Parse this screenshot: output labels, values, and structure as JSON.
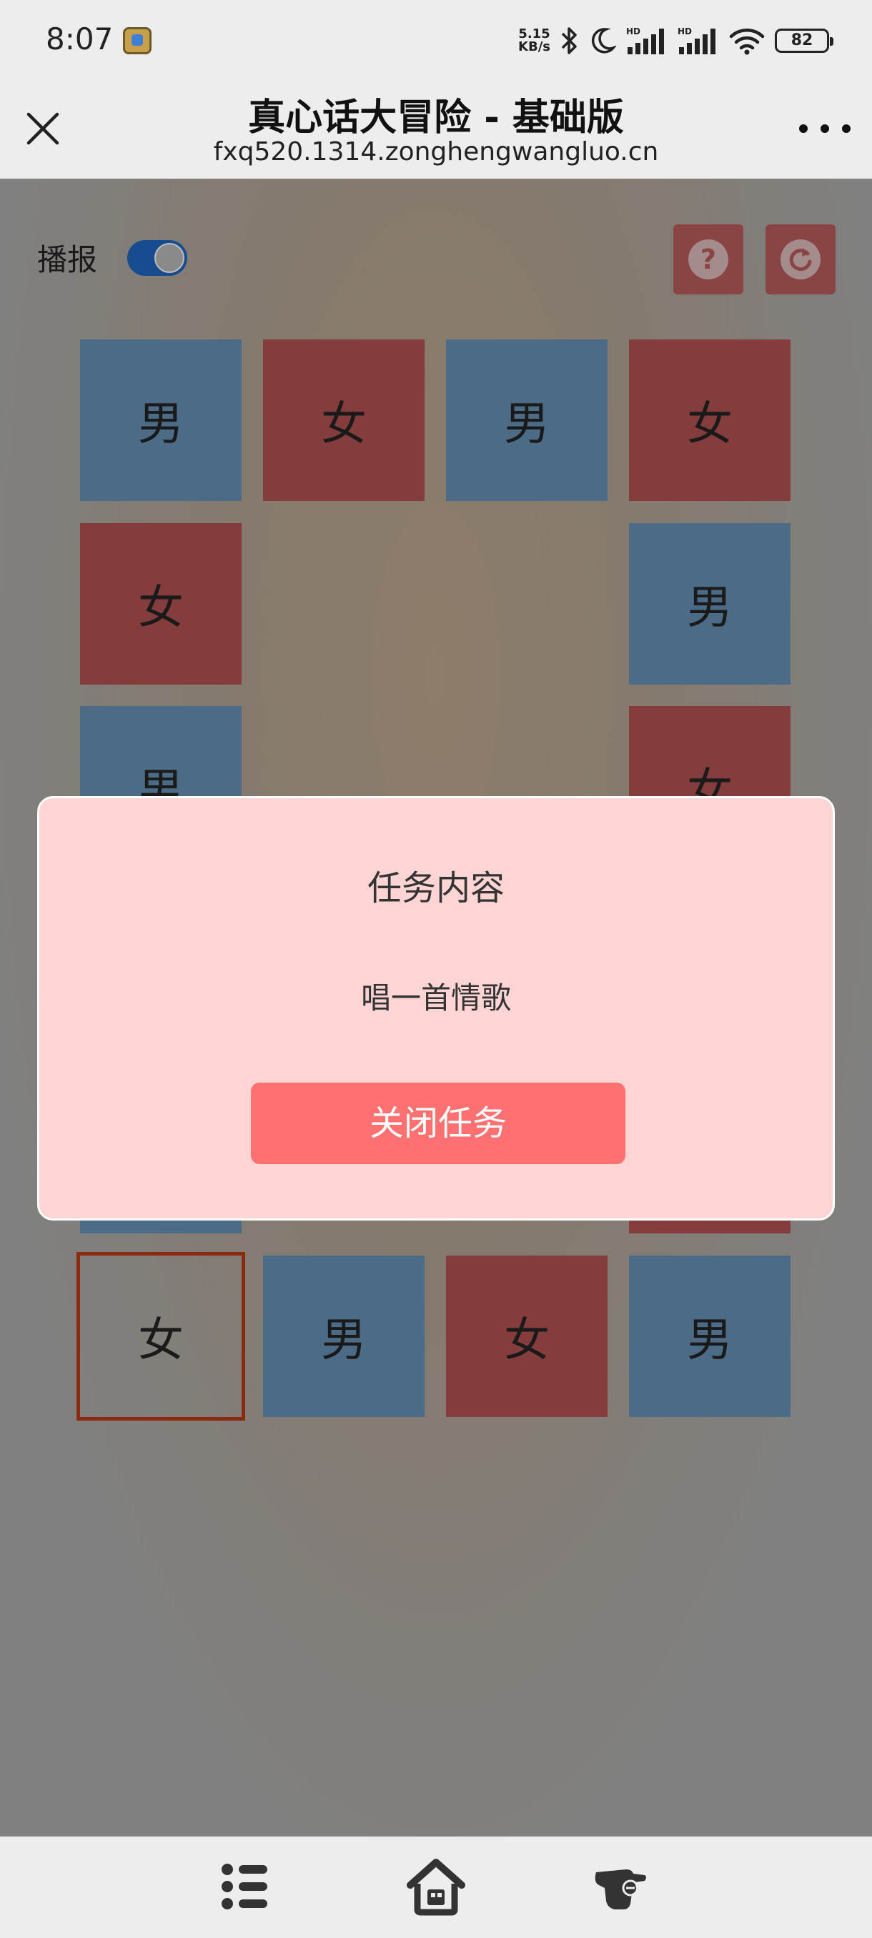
{
  "status_bar": {
    "time": "8:07",
    "net_speed_value": "5.15",
    "net_speed_unit": "KB/s",
    "battery": "82"
  },
  "header": {
    "title": "真心话大冒险 - 基础版",
    "url": "fxq520.1314.zonghengwangluo.cn"
  },
  "controls": {
    "broadcast_label": "播报",
    "broadcast_on": true,
    "help_glyph": "?"
  },
  "board": {
    "cells": [
      "男",
      "女",
      "男",
      "女",
      "女",
      "男",
      "男",
      "女",
      "女",
      "男",
      "女",
      "男"
    ]
  },
  "modal": {
    "title": "任务内容",
    "content": "唱一首情歌",
    "close_label": "关闭任务"
  },
  "colors": {
    "male": "#4b6b86",
    "female": "#853c3c",
    "modal_bg": "#fed4d4",
    "button": "#fe7170"
  },
  "bottom_nav": {
    "icons": [
      "list-icon",
      "home-icon",
      "hand-icon"
    ]
  }
}
